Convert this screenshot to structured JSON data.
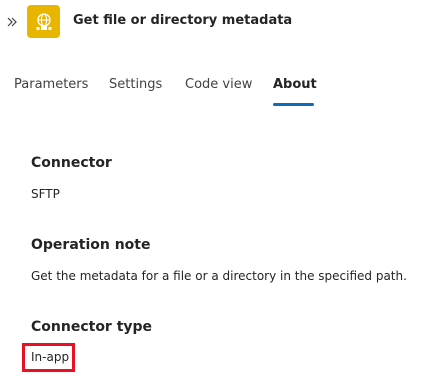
{
  "header": {
    "collapse_icon": "double-chevron-right-icon",
    "app_icon": "sftp-connector-icon",
    "accent_color": "#e8b500",
    "title": "Get file or directory metadata"
  },
  "tabs": [
    {
      "label": "Parameters",
      "active": false
    },
    {
      "label": "Settings",
      "active": false
    },
    {
      "label": "Code view",
      "active": false
    },
    {
      "label": "About",
      "active": true
    }
  ],
  "about": {
    "connector": {
      "heading": "Connector",
      "value": "SFTP"
    },
    "operation_note": {
      "heading": "Operation note",
      "value": "Get the metadata for a file or a directory in the specified path."
    },
    "connector_type": {
      "heading": "Connector type",
      "value": "In-app"
    }
  },
  "highlight_color": "#e81123",
  "active_tab_color": "#0f6cbd"
}
